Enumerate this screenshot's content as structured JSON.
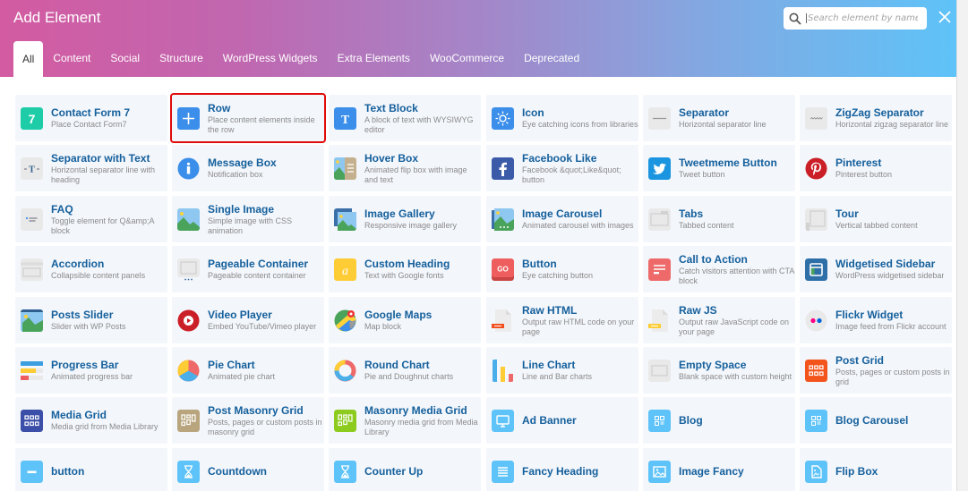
{
  "dialog": {
    "title": "Add Element",
    "search_placeholder": "Search element by name",
    "search_value": "",
    "close_icon": "close-icon"
  },
  "tabs": [
    {
      "label": "All",
      "active": true
    },
    {
      "label": "Content",
      "active": false
    },
    {
      "label": "Social",
      "active": false
    },
    {
      "label": "Structure",
      "active": false
    },
    {
      "label": "WordPress Widgets",
      "active": false
    },
    {
      "label": "Extra Elements",
      "active": false
    },
    {
      "label": "WooCommerce",
      "active": false
    },
    {
      "label": "Deprecated",
      "active": false
    }
  ],
  "colors": {
    "header_gradient_start": "#d35ba1",
    "header_gradient_end": "#5ec3f8",
    "element_title": "#15609c",
    "element_desc": "#8a8a8a",
    "tile_bg": "#f3f6fb",
    "highlight": "#e00b0b"
  },
  "elements": [
    {
      "name": "Contact Form 7",
      "desc": "Place Contact Form7",
      "icon": "contact-form-7-icon"
    },
    {
      "name": "Row",
      "desc": "Place content elements inside the row",
      "icon": "plus-icon",
      "highlighted": true
    },
    {
      "name": "Text Block",
      "desc": "A block of text with WYSIWYG editor",
      "icon": "text-t-icon"
    },
    {
      "name": "Icon",
      "desc": "Eye catching icons from libraries",
      "icon": "sun-icon"
    },
    {
      "name": "Separator",
      "desc": "Horizontal separator line",
      "icon": "separator-line-icon"
    },
    {
      "name": "ZigZag Separator",
      "desc": "Horizontal zigzag separator line",
      "icon": "zigzag-icon"
    },
    {
      "name": "Separator with Text",
      "desc": "Horizontal separator line with heading",
      "icon": "separator-text-icon"
    },
    {
      "name": "Message Box",
      "desc": "Notification box",
      "icon": "info-icon"
    },
    {
      "name": "Hover Box",
      "desc": "Animated flip box with image and text",
      "icon": "hover-box-icon"
    },
    {
      "name": "Facebook Like",
      "desc": "Facebook &quot;Like&quot; button",
      "icon": "facebook-icon"
    },
    {
      "name": "Tweetmeme Button",
      "desc": "Tweet button",
      "icon": "twitter-icon"
    },
    {
      "name": "Pinterest",
      "desc": "Pinterest button",
      "icon": "pinterest-icon"
    },
    {
      "name": "FAQ",
      "desc": "Toggle element for Q&amp;A block",
      "icon": "faq-icon"
    },
    {
      "name": "Single Image",
      "desc": "Simple image with CSS animation",
      "icon": "image-icon"
    },
    {
      "name": "Image Gallery",
      "desc": "Responsive image gallery",
      "icon": "gallery-icon"
    },
    {
      "name": "Image Carousel",
      "desc": "Animated carousel with images",
      "icon": "carousel-icon"
    },
    {
      "name": "Tabs",
      "desc": "Tabbed content",
      "icon": "tabs-icon"
    },
    {
      "name": "Tour",
      "desc": "Vertical tabbed content",
      "icon": "tour-icon"
    },
    {
      "name": "Accordion",
      "desc": "Collapsible content panels",
      "icon": "accordion-icon"
    },
    {
      "name": "Pageable Container",
      "desc": "Pageable content container",
      "icon": "pageable-icon"
    },
    {
      "name": "Custom Heading",
      "desc": "Text with Google fonts",
      "icon": "custom-heading-icon"
    },
    {
      "name": "Button",
      "desc": "Eye catching button",
      "icon": "go-button-icon"
    },
    {
      "name": "Call to Action",
      "desc": "Catch visitors attention with CTA block",
      "icon": "cta-icon"
    },
    {
      "name": "Widgetised Sidebar",
      "desc": "WordPress widgetised sidebar",
      "icon": "sidebar-icon"
    },
    {
      "name": "Posts Slider",
      "desc": "Slider with WP Posts",
      "icon": "posts-slider-icon"
    },
    {
      "name": "Video Player",
      "desc": "Embed YouTube/Vimeo player",
      "icon": "play-icon"
    },
    {
      "name": "Google Maps",
      "desc": "Map block",
      "icon": "map-icon"
    },
    {
      "name": "Raw HTML",
      "desc": "Output raw HTML code on your page",
      "icon": "raw-html-icon"
    },
    {
      "name": "Raw JS",
      "desc": "Output raw JavaScript code on your page",
      "icon": "raw-js-icon"
    },
    {
      "name": "Flickr Widget",
      "desc": "Image feed from Flickr account",
      "icon": "flickr-icon"
    },
    {
      "name": "Progress Bar",
      "desc": "Animated progress bar",
      "icon": "progress-bar-icon"
    },
    {
      "name": "Pie Chart",
      "desc": "Animated pie chart",
      "icon": "pie-chart-icon"
    },
    {
      "name": "Round Chart",
      "desc": "Pie and Doughnut charts",
      "icon": "donut-chart-icon"
    },
    {
      "name": "Line Chart",
      "desc": "Line and Bar charts",
      "icon": "bar-chart-icon"
    },
    {
      "name": "Empty Space",
      "desc": "Blank space with custom height",
      "icon": "empty-space-icon"
    },
    {
      "name": "Post Grid",
      "desc": "Posts, pages or custom posts in grid",
      "icon": "post-grid-icon"
    },
    {
      "name": "Media Grid",
      "desc": "Media grid from Media Library",
      "icon": "media-grid-icon"
    },
    {
      "name": "Post Masonry Grid",
      "desc": "Posts, pages or custom posts in masonry grid",
      "icon": "masonry-grid-icon"
    },
    {
      "name": "Masonry Media Grid",
      "desc": "Masonry media grid from Media Library",
      "icon": "masonry-media-icon"
    },
    {
      "name": "Ad Banner",
      "desc": "",
      "icon": "monitor-icon"
    },
    {
      "name": "Blog",
      "desc": "",
      "icon": "blog-icon"
    },
    {
      "name": "Blog Carousel",
      "desc": "",
      "icon": "blog-carousel-icon"
    },
    {
      "name": "button",
      "desc": "",
      "icon": "minus-button-icon"
    },
    {
      "name": "Countdown",
      "desc": "",
      "icon": "hourglass-icon"
    },
    {
      "name": "Counter Up",
      "desc": "",
      "icon": "hourglass-icon"
    },
    {
      "name": "Fancy Heading",
      "desc": "",
      "icon": "list-icon"
    },
    {
      "name": "Image Fancy",
      "desc": "",
      "icon": "image-fancy-icon"
    },
    {
      "name": "Flip Box",
      "desc": "",
      "icon": "flip-box-icon"
    }
  ]
}
